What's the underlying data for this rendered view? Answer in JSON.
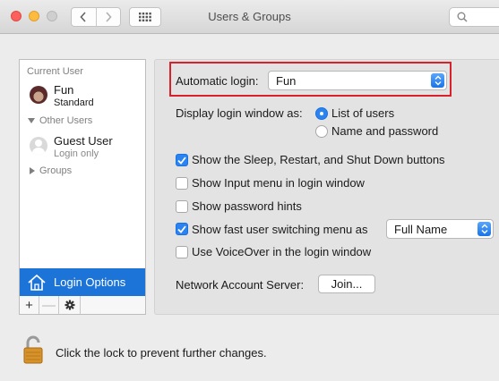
{
  "window": {
    "title": "Users & Groups",
    "traffic_colors": {
      "close": "#fc605c",
      "minimize": "#fdbc40",
      "maximize": "#cfcfcf"
    }
  },
  "sidebar": {
    "current_user_header": "Current User",
    "current_user": {
      "name": "Fun",
      "role": "Standard"
    },
    "other_users_header": "Other Users",
    "other_users": [
      {
        "name": "Guest User",
        "status": "Login only"
      }
    ],
    "groups_header": "Groups",
    "login_options_label": "Login Options",
    "selected_color": "#1c74d9",
    "toolbar": {
      "add": "+",
      "remove": "—"
    }
  },
  "login": {
    "automatic_login_label": "Automatic login:",
    "automatic_login_value": "Fun",
    "display_window_label": "Display login window as:",
    "display_options": [
      {
        "label": "List of users",
        "selected": true
      },
      {
        "label": "Name and password",
        "selected": false
      }
    ],
    "checkboxes": [
      {
        "label": "Show the Sleep, Restart, and Shut Down buttons",
        "checked": true
      },
      {
        "label": "Show Input menu in login window",
        "checked": false
      },
      {
        "label": "Show password hints",
        "checked": false
      },
      {
        "label": "Show fast user switching menu as",
        "checked": true
      },
      {
        "label": "Use VoiceOver in the login window",
        "checked": false
      }
    ],
    "fast_switch_value": "Full Name",
    "network_account_label": "Network Account Server:",
    "join_button": "Join..."
  },
  "footer": {
    "lock_text": "Click the lock to prevent further changes."
  },
  "accent_color": "#2a83f0",
  "highlight_color": "#d9212c"
}
